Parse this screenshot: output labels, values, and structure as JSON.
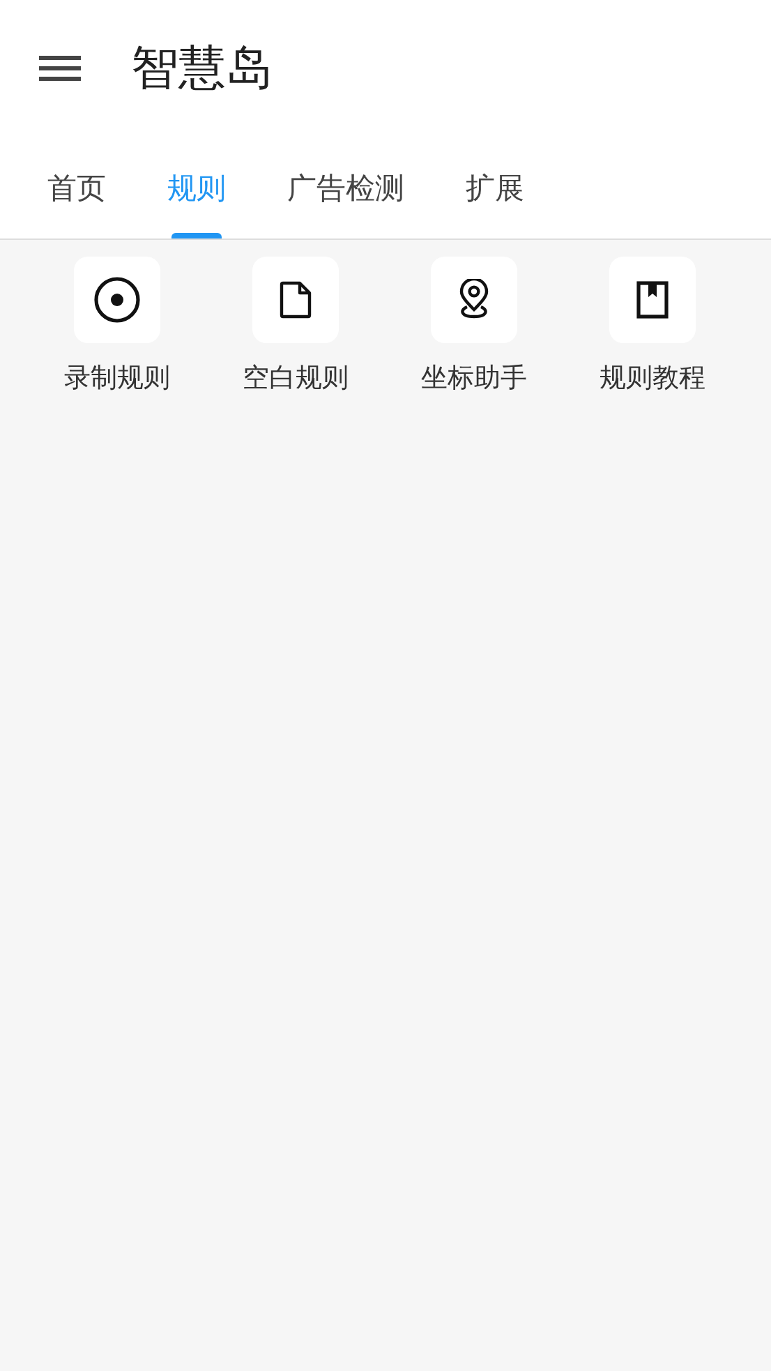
{
  "app_bar": {
    "title": "智慧岛"
  },
  "tabs": [
    {
      "label": "首页",
      "selected": false
    },
    {
      "label": "规则",
      "selected": true
    },
    {
      "label": "广告检测",
      "selected": false
    },
    {
      "label": "扩展",
      "selected": false
    }
  ],
  "tools": [
    {
      "kind": "record",
      "label": "录制规则"
    },
    {
      "kind": "blank",
      "label": "空白规则"
    },
    {
      "kind": "location",
      "label": "坐标助手"
    },
    {
      "kind": "tutorial",
      "label": "规则教程"
    }
  ]
}
